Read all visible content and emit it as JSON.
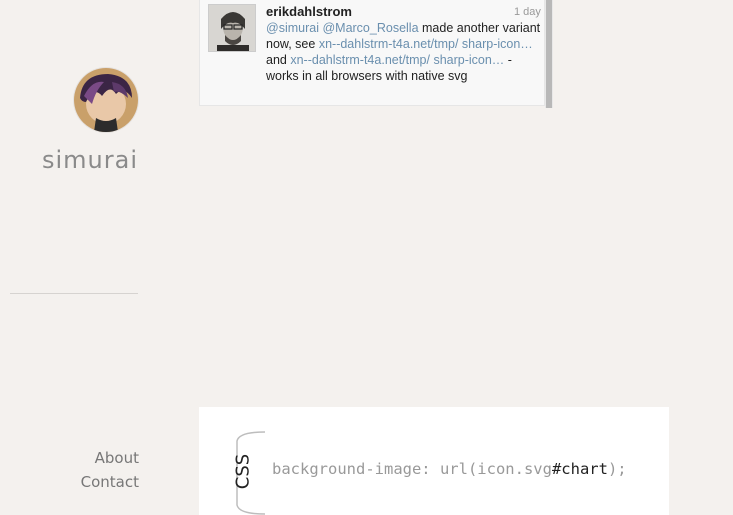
{
  "tweet": {
    "username": "erikdahlstrom",
    "time": "1 day",
    "mention1": "@simurai",
    "mention2": "@Marco_Rosella",
    "text1": " made another variant now, see ",
    "link1": "xn--dahlstrm-t4a.net/tmp/ sharp-icon…",
    "text2": " and ",
    "link2": "xn--dahlstrm-t4a.net/tmp/ sharp-icon…",
    "text3": " - works in all browsers with native svg"
  },
  "profile": {
    "name": "simurai"
  },
  "nav": {
    "about": "About",
    "contact": "Contact"
  },
  "code": {
    "tag": "CSS",
    "before": "background-image: url(icon.svg",
    "highlight": "#chart",
    "after": ");"
  },
  "colors": {
    "background": "#f4f1ee",
    "link": "#6a8fae",
    "muted_text": "#8a8a8a"
  }
}
